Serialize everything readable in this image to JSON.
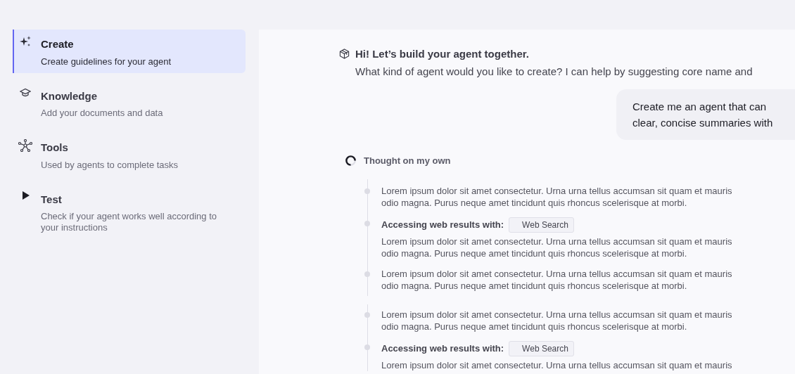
{
  "sidebar": {
    "items": [
      {
        "kind": "sparkles",
        "title": "Create",
        "subtitle": "Create guidelines for your agent",
        "selected": true
      },
      {
        "kind": "cap",
        "title": "Knowledge",
        "subtitle": "Add your documents and data",
        "selected": false
      },
      {
        "kind": "network",
        "title": "Tools",
        "subtitle": "Used by agents to complete tasks",
        "selected": false
      },
      {
        "kind": "play",
        "title": "Test",
        "subtitle": "Check if your agent works well according to your instructions",
        "selected": false
      }
    ]
  },
  "chat": {
    "greeting": {
      "title": "Hi! Let’s build your agent together.",
      "body": "What kind of agent would you like to create? I can help by suggesting core name and"
    },
    "user_message": [
      "Create me an agent that can",
      "clear, concise summaries with"
    ],
    "thought": {
      "label": "Thought on my own"
    },
    "steps": [
      [
        {
          "kind": "text",
          "lines": [
            "Lorem ipsum dolor sit amet consectetur. Urna urna tellus accumsan sit quam et mauris",
            "odio magna. Purus neque amet tincidunt quis rhoncus scelerisque at morbi."
          ]
        },
        {
          "kind": "tool",
          "label": "Accessing web results with:",
          "chip": "Web Search",
          "lines": [
            "Lorem ipsum dolor sit amet consectetur. Urna urna tellus accumsan sit quam et mauris",
            "odio magna. Purus neque amet tincidunt quis rhoncus scelerisque at morbi."
          ]
        },
        {
          "kind": "text",
          "lines": [
            "Lorem ipsum dolor sit amet consectetur. Urna urna tellus accumsan sit quam et mauris",
            "odio magna. Purus neque amet tincidunt quis rhoncus scelerisque at morbi."
          ]
        }
      ],
      [
        {
          "kind": "text",
          "lines": [
            "Lorem ipsum dolor sit amet consectetur. Urna urna tellus accumsan sit quam et mauris",
            "odio magna. Purus neque amet tincidunt quis rhoncus scelerisque at morbi."
          ]
        },
        {
          "kind": "tool",
          "label": "Accessing web results with:",
          "chip": "Web Search",
          "lines": [
            "Lorem ipsum dolor sit amet consectetur. Urna urna tellus accumsan sit quam et mauris"
          ]
        }
      ]
    ]
  }
}
